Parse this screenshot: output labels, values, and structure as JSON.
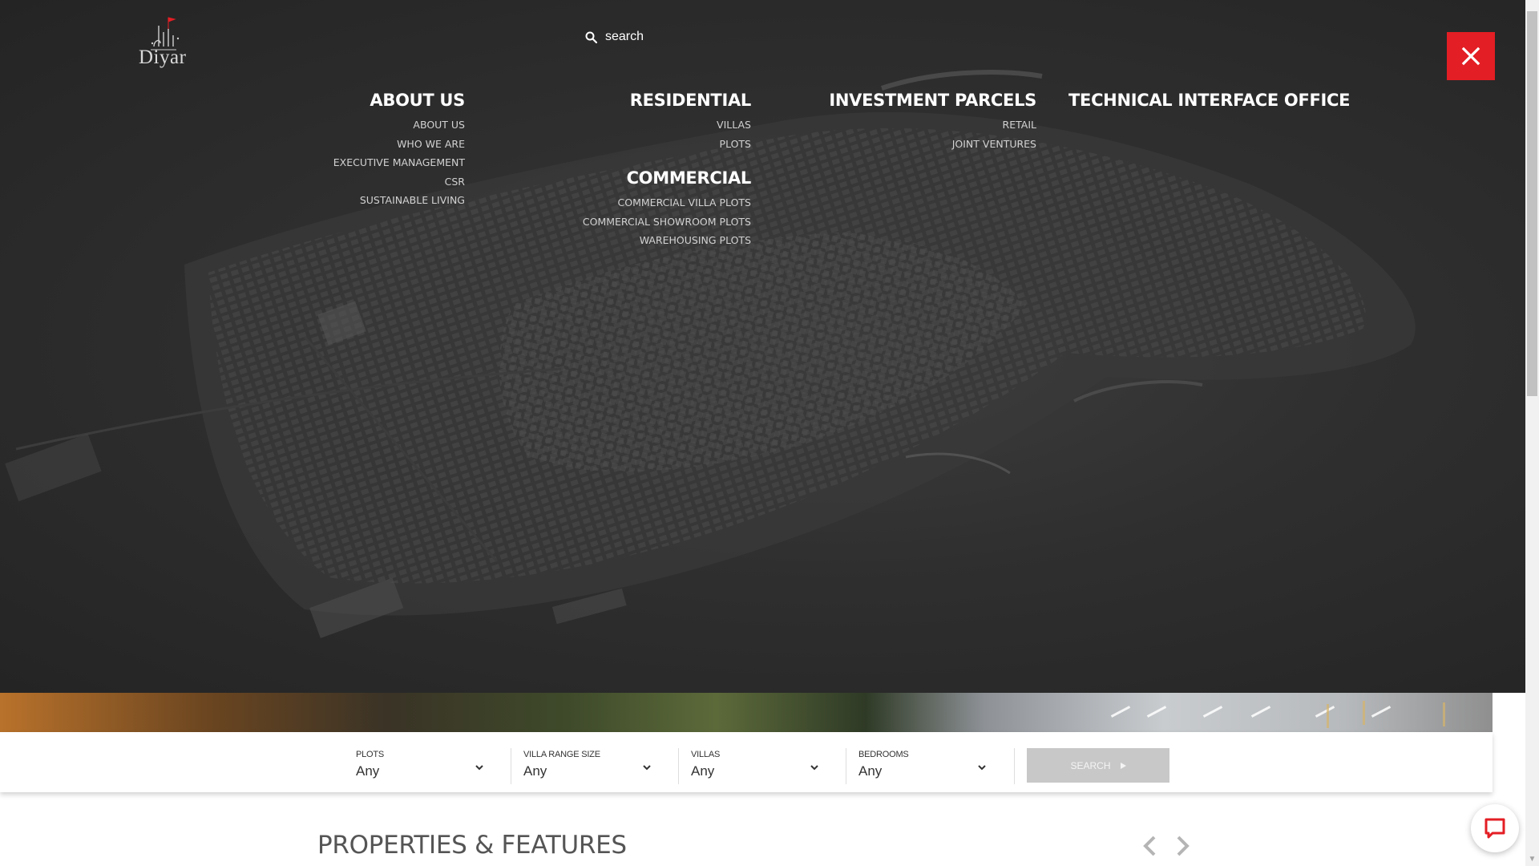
{
  "brand": {
    "logo_text": "Diyar"
  },
  "search": {
    "placeholder": "search"
  },
  "close": {
    "icon": "close-icon"
  },
  "menu": {
    "columns": [
      {
        "heading": "ABOUT US",
        "items": [
          "ABOUT US",
          "WHO WE ARE",
          "EXECUTIVE MANAGEMENT",
          "CSR",
          "SUSTAINABLE LIVING"
        ]
      },
      {
        "heading": "RESIDENTIAL",
        "items": [
          "VILLAS",
          "PLOTS"
        ]
      },
      {
        "heading": "COMMERCIAL",
        "items": [
          "COMMERCIAL VILLA PLOTS",
          "COMMERCIAL SHOWROOM PLOTS",
          "WAREHOUSING PLOTS"
        ]
      },
      {
        "heading": "INVESTMENT PARCELS",
        "items": [
          "RETAIL",
          "JOINT VENTURES"
        ]
      },
      {
        "heading": "TECHNICAL INTERFACE OFFICE",
        "items": []
      }
    ]
  },
  "filters": [
    {
      "label": "PLOTS",
      "value": "Any"
    },
    {
      "label": "VILLA RANGE SIZE",
      "value": "Any"
    },
    {
      "label": "VILLAS",
      "value": "Any"
    },
    {
      "label": "BEDROOMS",
      "value": "Any"
    }
  ],
  "search_button": {
    "label": "SEARCH"
  },
  "properties": {
    "title": "PROPERTIES & FEATURES"
  },
  "colors": {
    "close_bg": "#e31e24",
    "chat_accent": "#e31e24",
    "search_button_bg": "#c8c8c8"
  }
}
